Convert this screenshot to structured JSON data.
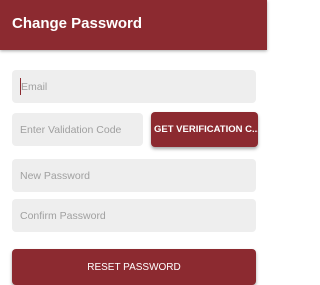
{
  "header": {
    "title": "Change Password"
  },
  "form": {
    "email": {
      "placeholder": "Email",
      "value": ""
    },
    "validation_code": {
      "placeholder": "Enter Validation Code",
      "value": ""
    },
    "get_verification_label": "GET VERIFICATION C...",
    "new_password": {
      "placeholder": "New Password",
      "value": ""
    },
    "confirm_password": {
      "placeholder": "Confirm Password",
      "value": ""
    },
    "reset_label": "RESET PASSWORD"
  },
  "colors": {
    "primary": "#8c2a30",
    "field_background": "#eeeeee",
    "placeholder_text": "#a0a0a0",
    "button_text": "#ffffff"
  }
}
